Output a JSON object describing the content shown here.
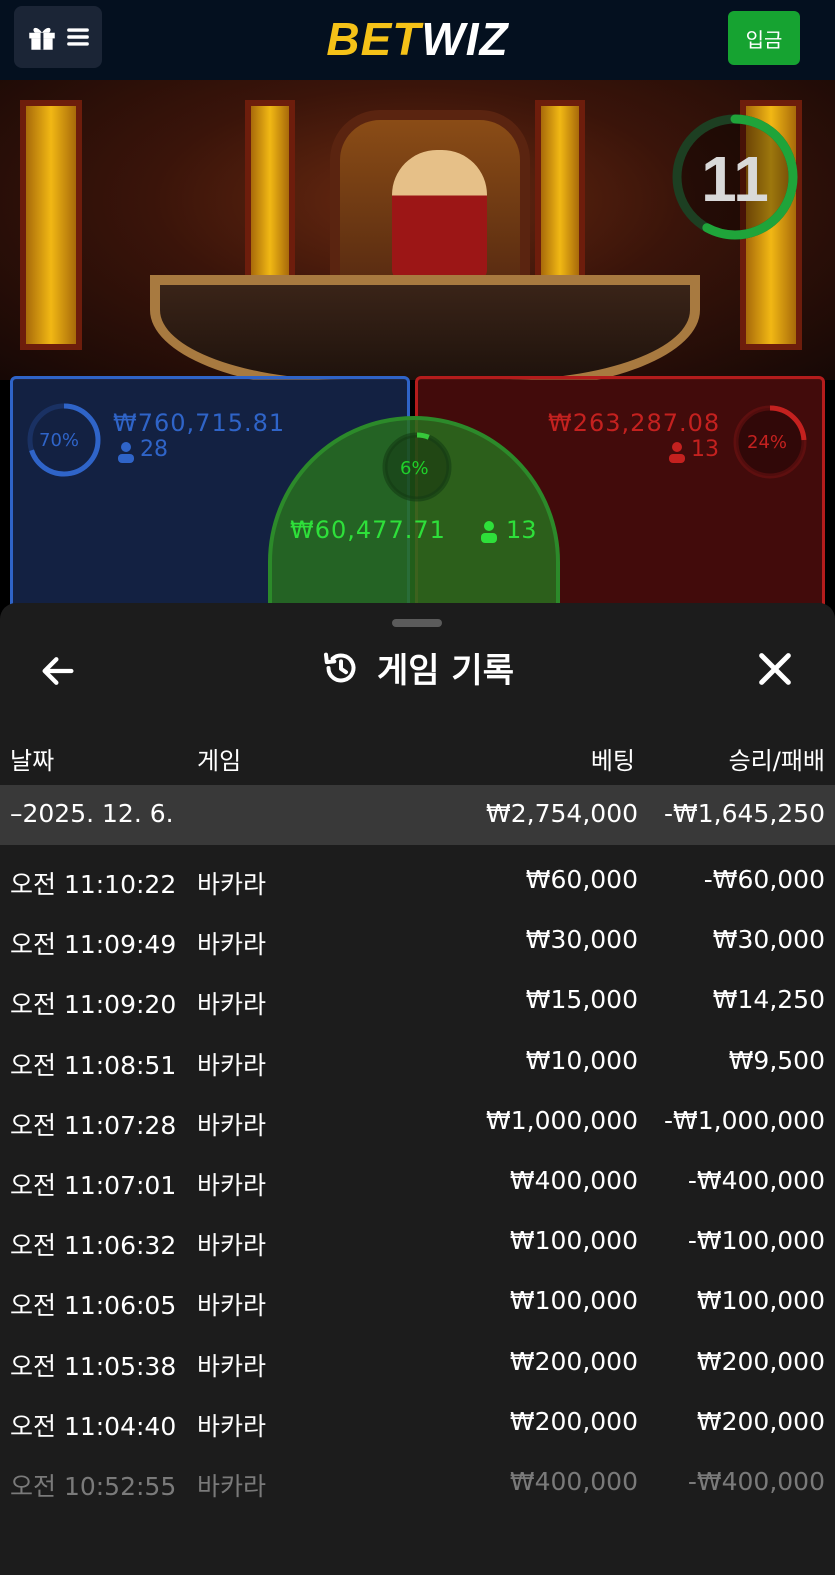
{
  "header": {
    "logo_bet": "BET",
    "logo_wiz": "WIZ",
    "deposit_label": "입금"
  },
  "video": {
    "timer_value": "11",
    "timer_progress": 0.58
  },
  "betting": {
    "player": {
      "percent": "70%",
      "amount": "₩760,715.81",
      "count": "28",
      "color": "#2f64c8"
    },
    "banker": {
      "percent": "24%",
      "amount": "₩263,287.08",
      "count": "13",
      "color": "#b41c1c"
    },
    "tie": {
      "percent": "6%",
      "amount": "₩60,477.71",
      "count": "13",
      "color": "#2c8a2a"
    }
  },
  "history": {
    "title": "게임 기록",
    "columns": {
      "date": "날짜",
      "game": "게임",
      "bet": "베팅",
      "result": "승리/패배"
    },
    "date_group": {
      "label": "–2025. 12. 6.",
      "bet": "₩2,754,000",
      "result": "-₩1,645,250"
    },
    "rows": [
      {
        "time": "오전 11:10:22",
        "game": "바카라",
        "bet": "₩60,000",
        "result": "-₩60,000"
      },
      {
        "time": "오전 11:09:49",
        "game": "바카라",
        "bet": "₩30,000",
        "result": "₩30,000"
      },
      {
        "time": "오전 11:09:20",
        "game": "바카라",
        "bet": "₩15,000",
        "result": "₩14,250"
      },
      {
        "time": "오전 11:08:51",
        "game": "바카라",
        "bet": "₩10,000",
        "result": "₩9,500"
      },
      {
        "time": "오전 11:07:28",
        "game": "바카라",
        "bet": "₩1,000,000",
        "result": "-₩1,000,000"
      },
      {
        "time": "오전 11:07:01",
        "game": "바카라",
        "bet": "₩400,000",
        "result": "-₩400,000"
      },
      {
        "time": "오전 11:06:32",
        "game": "바카라",
        "bet": "₩100,000",
        "result": "-₩100,000"
      },
      {
        "time": "오전 11:06:05",
        "game": "바카라",
        "bet": "₩100,000",
        "result": "₩100,000"
      },
      {
        "time": "오전 11:05:38",
        "game": "바카라",
        "bet": "₩200,000",
        "result": "₩200,000"
      },
      {
        "time": "오전 11:04:40",
        "game": "바카라",
        "bet": "₩200,000",
        "result": "₩200,000"
      },
      {
        "time": "오전 10:52:55",
        "game": "바카라",
        "bet": "₩400,000",
        "result": "-₩400,000"
      }
    ]
  },
  "icons": {
    "gift": "gift-icon",
    "menu": "hamburger-menu-icon",
    "back": "arrow-left-icon",
    "history": "history-clock-icon",
    "close": "close-icon",
    "user": "user-icon"
  }
}
